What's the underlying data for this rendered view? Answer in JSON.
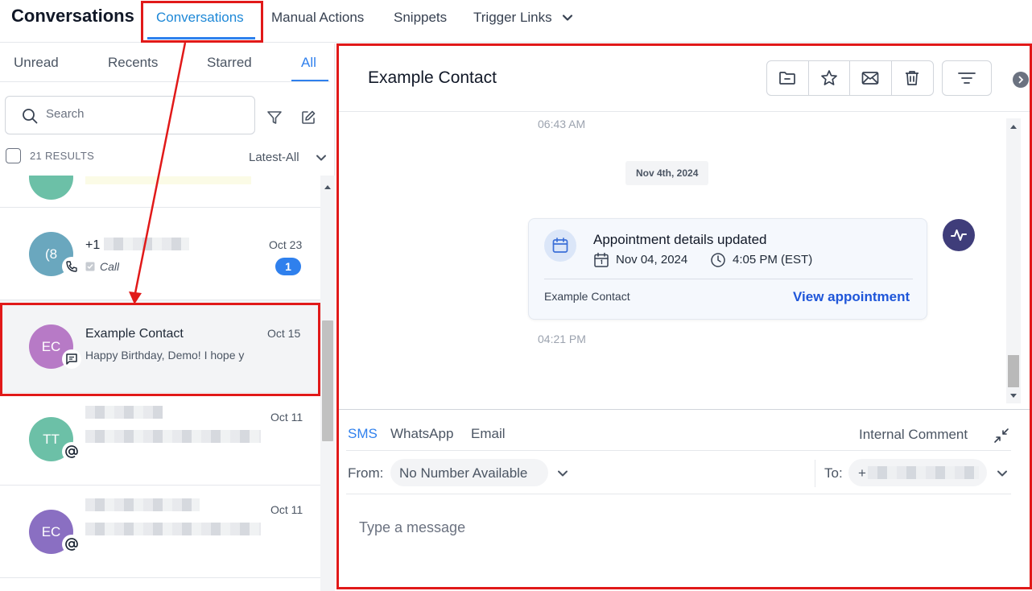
{
  "app": {
    "title": "Conversations"
  },
  "nav": {
    "tabs": [
      {
        "label": "Conversations",
        "active": true
      },
      {
        "label": "Manual Actions"
      },
      {
        "label": "Snippets"
      },
      {
        "label": "Trigger Links"
      }
    ]
  },
  "filters": {
    "tabs": [
      {
        "label": "Unread"
      },
      {
        "label": "Recents"
      },
      {
        "label": "Starred"
      },
      {
        "label": "All",
        "active": true
      }
    ]
  },
  "search": {
    "placeholder": "Search"
  },
  "results": {
    "count_label": "21 RESULTS",
    "sort_label": "Latest-All"
  },
  "conversations": [
    {
      "avatar_initials": "(8",
      "avatar_color": "#6aa7be",
      "name": "+1",
      "date": "Oct 23",
      "preview": "Call",
      "channel_icon": "phone-icon",
      "unread": "1"
    },
    {
      "avatar_initials": "EC",
      "avatar_color": "#b77ac6",
      "name": "Example Contact",
      "date": "Oct 15",
      "preview": "Happy Birthday, Demo! I hope y",
      "channel_icon": "sms-icon",
      "selected": true
    },
    {
      "avatar_initials": "TT",
      "avatar_color": "#6cc0a7",
      "date": "Oct 11",
      "channel_icon": "at-icon"
    },
    {
      "avatar_initials": "EC",
      "avatar_color": "#8a6fc2",
      "date": "Oct 11",
      "channel_icon": "at-icon"
    }
  ],
  "thread": {
    "contact_name": "Example Contact",
    "messages": {
      "time_before": "06:43 AM",
      "date_separator": "Nov 4th, 2024",
      "appointment": {
        "title": "Appointment details updated",
        "date": "Nov 04, 2024",
        "time": "4:05 PM (EST)",
        "contact": "Example Contact",
        "link_label": "View appointment"
      },
      "time_after": "04:21 PM"
    }
  },
  "composer": {
    "tabs": [
      {
        "label": "SMS",
        "active": true
      },
      {
        "label": "WhatsApp"
      },
      {
        "label": "Email"
      }
    ],
    "internal_label": "Internal Comment",
    "from_label": "From:",
    "from_value": "No Number Available",
    "to_label": "To:",
    "to_value": "+",
    "placeholder": "Type a message"
  },
  "colors": {
    "accent": "#2f80ed",
    "annotation": "#e11919",
    "link": "#1f56d9"
  }
}
